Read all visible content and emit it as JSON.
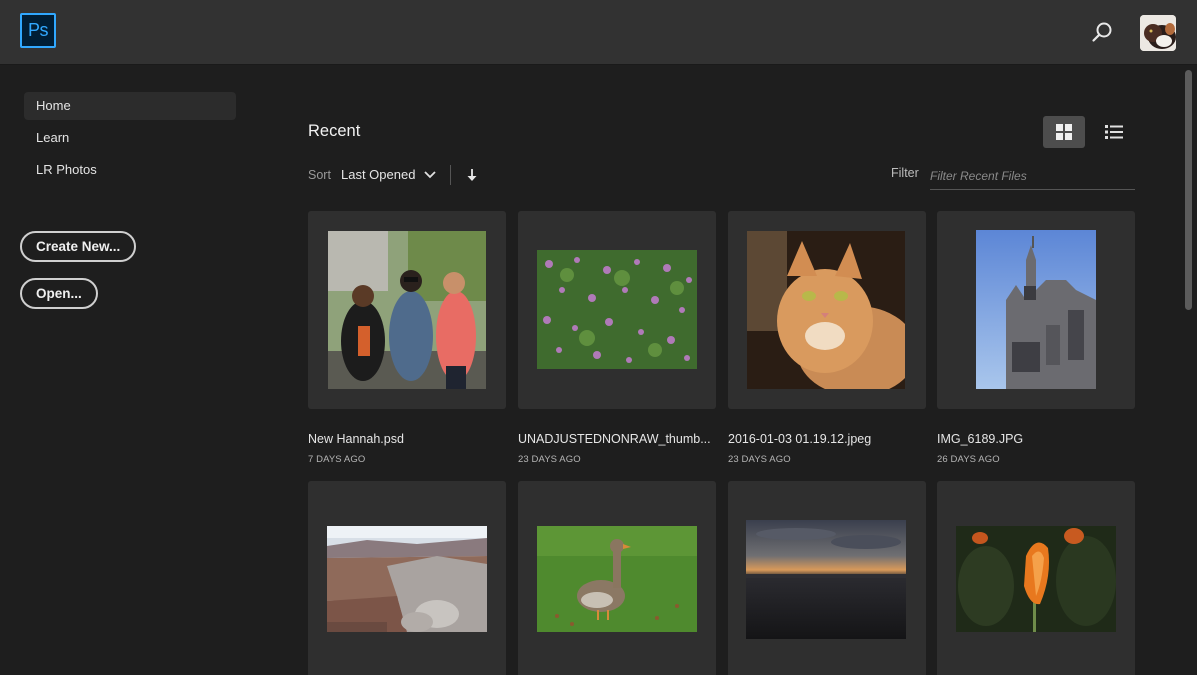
{
  "app": {
    "logo_text": "Ps"
  },
  "header": {
    "search_icon": "search-icon",
    "avatar": "user-avatar"
  },
  "sidebar": {
    "items": [
      {
        "label": "Home",
        "active": true
      },
      {
        "label": "Learn",
        "active": false
      },
      {
        "label": "LR Photos",
        "active": false
      }
    ],
    "create_new_label": "Create New...",
    "open_label": "Open..."
  },
  "recent": {
    "title": "Recent",
    "sort_label": "Sort",
    "sort_value": "Last Opened",
    "filter_label": "Filter",
    "filter_placeholder": "Filter Recent Files",
    "view_mode": "grid"
  },
  "files": [
    {
      "name": "New Hannah.psd",
      "date": "7 DAYS AGO"
    },
    {
      "name": "UNADJUSTEDNONRAW_thumb...",
      "date": "23 DAYS AGO"
    },
    {
      "name": "2016-01-03 01.19.12.jpeg",
      "date": "23 DAYS AGO"
    },
    {
      "name": "IMG_6189.JPG",
      "date": "26 DAYS AGO"
    },
    {
      "name": "",
      "date": ""
    },
    {
      "name": "",
      "date": ""
    },
    {
      "name": "",
      "date": ""
    },
    {
      "name": "",
      "date": ""
    }
  ],
  "colors": {
    "accent": "#31a8ff",
    "background": "#1e1e1e",
    "topbar": "#323232",
    "card": "#2f2f2f"
  }
}
